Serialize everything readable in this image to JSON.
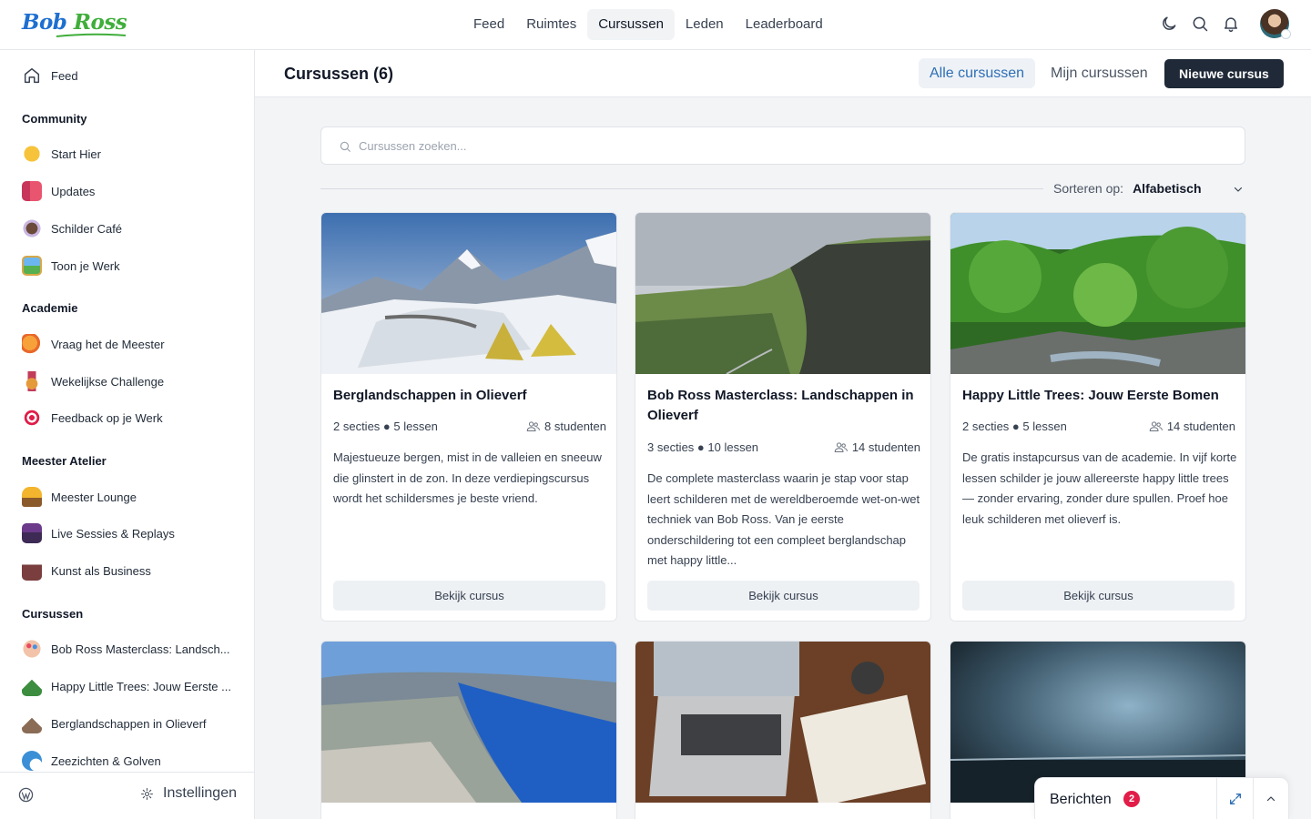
{
  "brand": {
    "logo_part1": "Bob",
    "logo_part2": "Ross"
  },
  "nav": [
    "Feed",
    "Ruimtes",
    "Cursussen",
    "Leden",
    "Leaderboard"
  ],
  "nav_active": "Cursussen",
  "header_icons": [
    "moon-icon",
    "search-icon",
    "bell-icon",
    "avatar"
  ],
  "sidebar": {
    "feed": "Feed",
    "sections": [
      {
        "title": "Community",
        "items": [
          "Start Hier",
          "Updates",
          "Schilder Café",
          "Toon je Werk"
        ]
      },
      {
        "title": "Academie",
        "items": [
          "Vraag het de Meester",
          "Wekelijkse Challenge",
          "Feedback op je Werk"
        ]
      },
      {
        "title": "Meester Atelier",
        "items": [
          "Meester Lounge",
          "Live Sessies & Replays",
          "Kunst als Business"
        ]
      },
      {
        "title": "Cursussen",
        "items": [
          "Bob Ross Masterclass: Landsch...",
          "Happy Little Trees: Jouw Eerste ...",
          "Berglandschappen in Olieverf",
          "Zeezichten & Golven"
        ]
      }
    ],
    "settings": "Instellingen"
  },
  "page": {
    "title": "Cursussen (6)",
    "tab_all": "Alle cursussen",
    "tab_mine": "Mijn cursussen",
    "new_course": "Nieuwe cursus",
    "search_placeholder": "Cursussen zoeken...",
    "sort_label": "Sorteren op:",
    "sort_value": "Alfabetisch"
  },
  "courses": [
    {
      "title": "Berglandschappen in Olieverf",
      "sections": "2 secties",
      "lessons": "5 lessen",
      "students": "8 studenten",
      "desc": "Majestueuze bergen, mist in de valleien en sneeuw die glinstert in de zon. In deze verdiepingscursus wordt het schildersmes je beste vriend.",
      "button": "Bekijk cursus"
    },
    {
      "title": "Bob Ross Masterclass: Landschappen in Olieverf",
      "sections": "3 secties",
      "lessons": "10 lessen",
      "students": "14 studenten",
      "desc": "De complete masterclass waarin je stap voor stap leert schilderen met de wereldberoemde wet-on-wet techniek van Bob Ross. Van je eerste onderschildering tot een compleet berglandschap met happy little...",
      "button": "Bekijk cursus"
    },
    {
      "title": "Happy Little Trees: Jouw Eerste Bomen",
      "sections": "2 secties",
      "lessons": "5 lessen",
      "students": "14 studenten",
      "desc": "De gratis instapcursus van de academie. In vijf korte lessen schilder je jouw allereerste happy little trees — zonder ervaring, zonder dure spullen. Proef hoe leuk schilderen met olieverf is.",
      "button": "Bekijk cursus"
    }
  ],
  "messages": {
    "label": "Berichten",
    "count": "2"
  }
}
